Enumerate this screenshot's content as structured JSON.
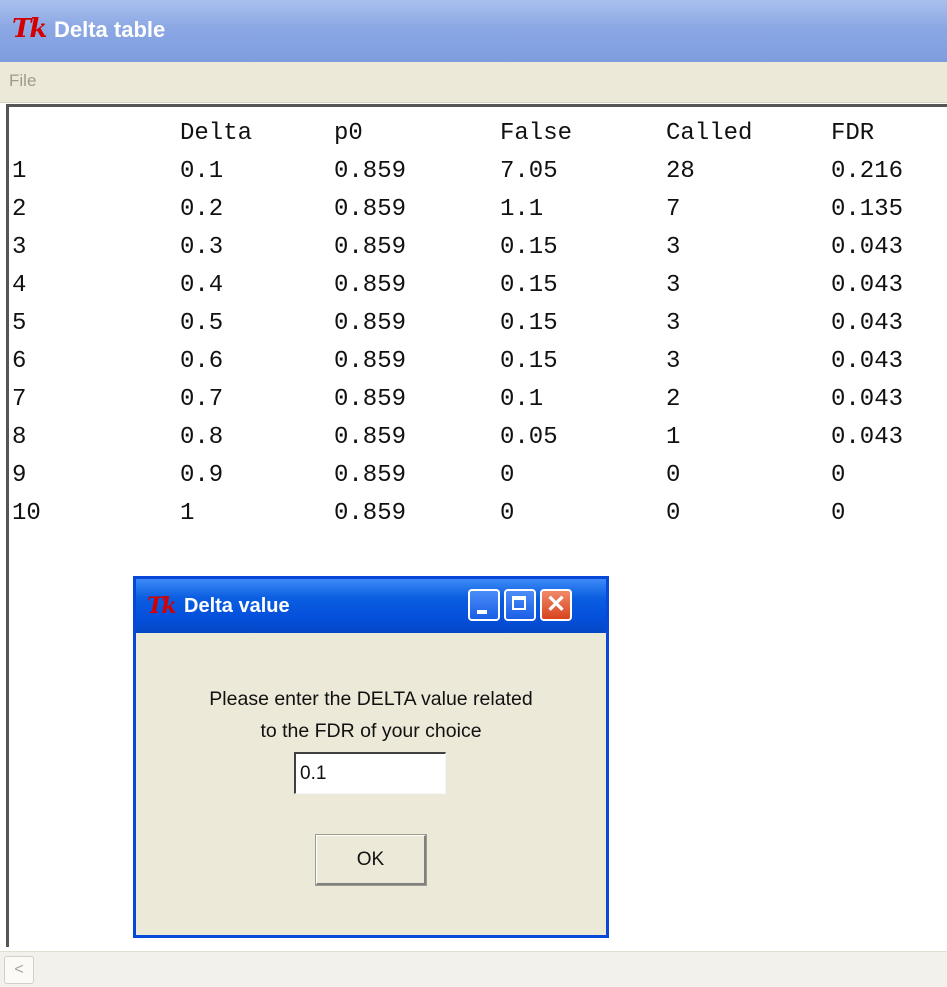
{
  "window": {
    "title": "Delta table",
    "logo": "Tk"
  },
  "menu": {
    "file": "File"
  },
  "table": {
    "headers": [
      "",
      "Delta",
      "p0",
      "False",
      "Called",
      "FDR"
    ],
    "rows": [
      [
        "1",
        "0.1",
        "0.859",
        "7.05",
        "28",
        "0.216"
      ],
      [
        "2",
        "0.2",
        "0.859",
        "1.1",
        "7",
        "0.135"
      ],
      [
        "3",
        "0.3",
        "0.859",
        "0.15",
        "3",
        "0.043"
      ],
      [
        "4",
        "0.4",
        "0.859",
        "0.15",
        "3",
        "0.043"
      ],
      [
        "5",
        "0.5",
        "0.859",
        "0.15",
        "3",
        "0.043"
      ],
      [
        "6",
        "0.6",
        "0.859",
        "0.15",
        "3",
        "0.043"
      ],
      [
        "7",
        "0.7",
        "0.859",
        "0.1",
        "2",
        "0.043"
      ],
      [
        "8",
        "0.8",
        "0.859",
        "0.05",
        "1",
        "0.043"
      ],
      [
        "9",
        "0.9",
        "0.859",
        "0",
        "0",
        "0"
      ],
      [
        "10",
        "1",
        "0.859",
        "0",
        "0",
        "0"
      ]
    ]
  },
  "dialog": {
    "title": "Delta value",
    "logo": "Tk",
    "prompt_line1": "Please enter the DELTA value related",
    "prompt_line2": "to the FDR of your choice",
    "input_value": "0.1",
    "ok_label": "OK",
    "close_glyph": "✕"
  },
  "scrollbar": {
    "left_arrow": "<"
  },
  "colors": {
    "main_titlebar": "#8ba7e4",
    "dialog_titlebar": "#0a5ee0",
    "dialog_border": "#0848d8",
    "face": "#ece9d8",
    "logo": "#d40000"
  }
}
